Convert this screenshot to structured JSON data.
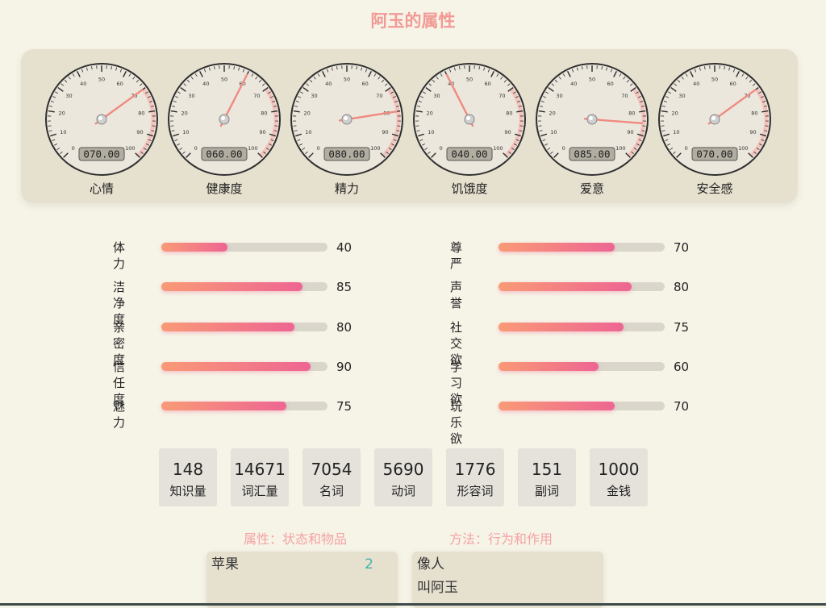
{
  "title": "阿玉的属性",
  "gauges": [
    {
      "name": "心情",
      "value": 70,
      "display": "070.00"
    },
    {
      "name": "健康度",
      "value": 60,
      "display": "060.00"
    },
    {
      "name": "精力",
      "value": 80,
      "display": "080.00"
    },
    {
      "name": "饥饿度",
      "value": 40,
      "display": "040.00"
    },
    {
      "name": "爱意",
      "value": 85,
      "display": "085.00"
    },
    {
      "name": "安全感",
      "value": 70,
      "display": "070.00"
    }
  ],
  "gauge_scale": {
    "min": 0,
    "max": 100,
    "tick_labels": [
      "0",
      "10",
      "20",
      "30",
      "40",
      "50",
      "60",
      "70",
      "80",
      "90",
      "100"
    ]
  },
  "stats_left": [
    {
      "label": "体力",
      "value": 40
    },
    {
      "label": "洁净度",
      "value": 85
    },
    {
      "label": "亲密度",
      "value": 80
    },
    {
      "label": "信任度",
      "value": 90
    },
    {
      "label": "魅力",
      "value": 75
    }
  ],
  "stats_right": [
    {
      "label": "尊严",
      "value": 70
    },
    {
      "label": "声誉",
      "value": 80
    },
    {
      "label": "社交欲",
      "value": 75
    },
    {
      "label": "学习欲",
      "value": 60
    },
    {
      "label": "玩乐欲",
      "value": 70
    }
  ],
  "counts": [
    {
      "value": "148",
      "label": "知识量"
    },
    {
      "value": "14671",
      "label": "词汇量"
    },
    {
      "value": "7054",
      "label": "名词"
    },
    {
      "value": "5690",
      "label": "动词"
    },
    {
      "value": "1776",
      "label": "形容词"
    },
    {
      "value": "151",
      "label": "副词"
    },
    {
      "value": "1000",
      "label": "金钱"
    }
  ],
  "sections": {
    "properties_header": "属性：状态和物品",
    "methods_header": "方法：行为和作用",
    "properties_items": [
      {
        "name": "苹果",
        "count": "2"
      }
    ],
    "methods_items": [
      "像人",
      "叫阿玉"
    ]
  },
  "colors": {
    "accent": "#f29a95",
    "bar_start": "#f99a76",
    "bar_end": "#ee6593",
    "needle": "#f08a80",
    "count_text": "#3fb3a8"
  }
}
